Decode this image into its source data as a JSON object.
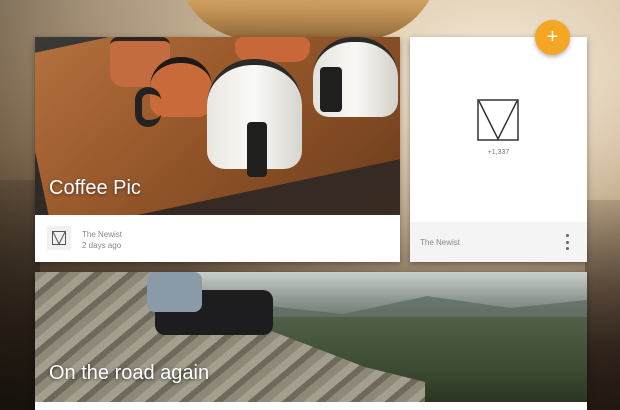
{
  "cards": [
    {
      "title": "Coffee Pic",
      "author": "The Newist",
      "time": "2 days ago"
    },
    {
      "count": "+1,337",
      "author": "The Newist"
    },
    {
      "title": "On the road again"
    }
  ],
  "fab": {
    "label": "+"
  },
  "icons": {
    "logo": "newist-logo-icon",
    "menu": "more-vert-icon",
    "fab": "add-icon"
  },
  "colors": {
    "accent": "#f5a623"
  }
}
